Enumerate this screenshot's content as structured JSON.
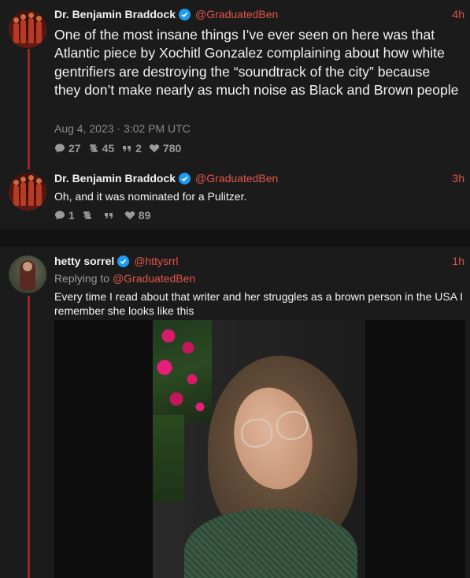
{
  "tweets": [
    {
      "name": "Dr. Benjamin Braddock",
      "handle": "@GraduatedBen",
      "time": "4h",
      "text": "One of the most insane things I’ve ever seen on here was that Atlantic piece by Xochitl Gonzalez complaining about how white gentrifiers are destroying the “soundtrack of the city” because they don’t make nearly as much noise as Black and Brown people",
      "date": "Aug 4, 2023 · 3:02 PM UTC",
      "stats": {
        "replies": "27",
        "retweets": "45",
        "quotes": "2",
        "likes": "780"
      }
    },
    {
      "name": "Dr. Benjamin Braddock",
      "handle": "@GraduatedBen",
      "time": "3h",
      "text": "Oh, and it was nominated for a Pulitzer.",
      "stats": {
        "replies": "1",
        "retweets": "",
        "quotes": "",
        "likes": "89"
      }
    },
    {
      "name": "hetty sorrel",
      "handle": "@httysrrl",
      "time": "1h",
      "replying_label": "Replying to",
      "replying_to": "@GraduatedBen",
      "text": "Every time I read about that writer and her struggles as a brown person in the USA I remember she looks like this"
    }
  ],
  "icons": {
    "verified": "verified-badge-icon",
    "reply": "speech-bubble-icon",
    "retweet": "retweet-icon",
    "quote": "quote-icon",
    "like": "heart-icon"
  },
  "colors": {
    "accent": "#e0564b",
    "thread_line": "#8f2a24",
    "verified": "#1d9bf0",
    "background": "#1b1b1b"
  }
}
